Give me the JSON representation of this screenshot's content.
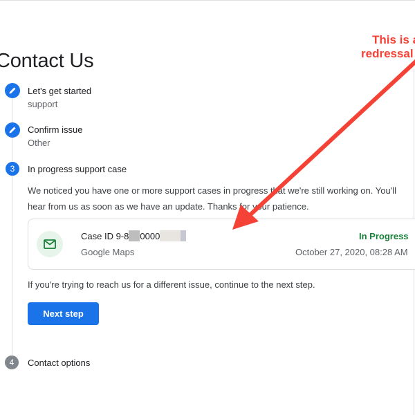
{
  "page": {
    "title": "Contact Us"
  },
  "steps": [
    {
      "number": "1",
      "title": "Let's get started",
      "subtitle": "support",
      "icon": "pencil-icon"
    },
    {
      "number": "2",
      "title": "Confirm issue",
      "subtitle": "Other",
      "icon": "pencil-icon"
    },
    {
      "number": "3",
      "title": "In progress support case",
      "subtitle": ""
    },
    {
      "number": "4",
      "title": "Contact options",
      "subtitle": ""
    }
  ],
  "case_section": {
    "message": "We noticed you have one or more support cases in progress that we're still working on. You'll hear from us as soon as we have an update. Thanks for your patience.",
    "card": {
      "case_id_prefix": "Case ID 9-8",
      "case_id_middle": "0000",
      "product": "Google Maps",
      "status": "In Progress",
      "date": "October 27, 2020, 08:28 AM",
      "icon": "mail-icon"
    },
    "next_hint": "If you're trying to reach us for a different issue, continue to the next step.",
    "next_button": "Next step"
  },
  "annotation": {
    "line1": "This is a",
    "line2": "redressal"
  },
  "colors": {
    "accent": "#1a73e8",
    "status_green": "#188038",
    "annotation_red": "#f44336",
    "step_gray": "#80868b"
  }
}
